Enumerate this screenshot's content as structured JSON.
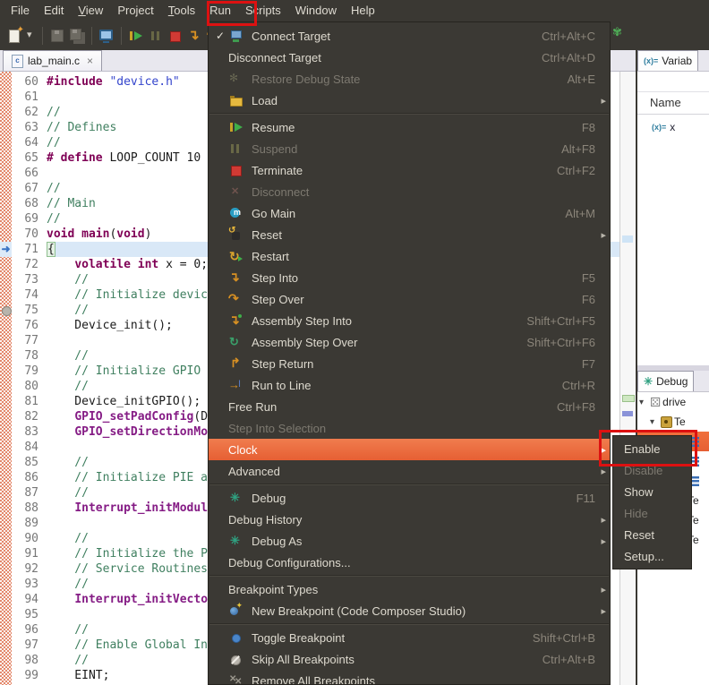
{
  "menubar": {
    "items": [
      {
        "label": "File",
        "underline": false
      },
      {
        "label": "Edit",
        "underline": false
      },
      {
        "label": "View",
        "underline": true
      },
      {
        "label": "Project",
        "underline": false
      },
      {
        "label": "Tools",
        "underline": true
      },
      {
        "label": "Run",
        "underline": false
      },
      {
        "label": "Scripts",
        "underline": false
      },
      {
        "label": "Window",
        "underline": false
      },
      {
        "label": "Help",
        "underline": false
      }
    ]
  },
  "toolbar": {
    "groups": [
      [
        {
          "icon": "new-file",
          "disabled": false
        },
        {
          "icon": "menu-dropdown-arrow",
          "disabled": false
        }
      ],
      [
        {
          "icon": "save",
          "disabled": true
        },
        {
          "icon": "save-all",
          "disabled": true
        }
      ],
      [
        {
          "icon": "debug-monitor",
          "disabled": false
        }
      ],
      [
        {
          "icon": "resume",
          "disabled": false
        },
        {
          "icon": "suspend",
          "disabled": true
        },
        {
          "icon": "terminate",
          "disabled": false
        },
        {
          "icon": "step-into",
          "disabled": false
        },
        {
          "icon": "step-over",
          "disabled": false
        },
        {
          "icon": "step-return",
          "disabled": false
        }
      ],
      [
        {
          "icon": "registers-grid",
          "disabled": false
        }
      ]
    ],
    "right_icon": "pin"
  },
  "editor": {
    "tab": {
      "label": "lab_main.c",
      "close": "×",
      "file_icon": "c"
    },
    "pointer_line": 71,
    "marker_line": 75,
    "lines": [
      {
        "num": 60,
        "segs": [
          [
            "#include",
            "kw"
          ],
          [
            " ",
            "pl"
          ],
          [
            "\"device.h\"",
            "str"
          ]
        ]
      },
      {
        "num": 61,
        "segs": []
      },
      {
        "num": 62,
        "segs": [
          [
            "//",
            "com"
          ]
        ]
      },
      {
        "num": 63,
        "segs": [
          [
            "// Defines",
            "com"
          ]
        ]
      },
      {
        "num": 64,
        "segs": [
          [
            "//",
            "com"
          ]
        ]
      },
      {
        "num": 65,
        "segs": [
          [
            "# define",
            "kw"
          ],
          [
            " LOOP_COUNT 10",
            "pl"
          ]
        ]
      },
      {
        "num": 66,
        "segs": []
      },
      {
        "num": 67,
        "segs": [
          [
            "//",
            "com"
          ]
        ]
      },
      {
        "num": 68,
        "segs": [
          [
            "// Main",
            "com"
          ]
        ]
      },
      {
        "num": 69,
        "segs": [
          [
            "//",
            "com"
          ]
        ]
      },
      {
        "num": 70,
        "segs": [
          [
            "void",
            "kw"
          ],
          [
            " ",
            "pl"
          ],
          [
            "main",
            "kw"
          ],
          [
            "(",
            "pl"
          ],
          [
            "void",
            "kw"
          ],
          [
            ")",
            "pl"
          ]
        ]
      },
      {
        "num": 71,
        "current": true,
        "segs": [
          [
            "{",
            "br"
          ]
        ]
      },
      {
        "num": 72,
        "segs": [
          [
            "    ",
            "pl"
          ],
          [
            "volatile",
            "kw"
          ],
          [
            " ",
            "pl"
          ],
          [
            "int",
            "kw"
          ],
          [
            " x = 0;",
            "pl"
          ]
        ]
      },
      {
        "num": 73,
        "segs": [
          [
            "    //",
            "com"
          ]
        ]
      },
      {
        "num": 74,
        "segs": [
          [
            "    // Initialize device",
            "com"
          ]
        ]
      },
      {
        "num": 75,
        "segs": [
          [
            "    //",
            "com"
          ]
        ]
      },
      {
        "num": 76,
        "segs": [
          [
            "    Device_init();",
            "pl"
          ]
        ]
      },
      {
        "num": 77,
        "segs": []
      },
      {
        "num": 78,
        "segs": [
          [
            "    //",
            "com"
          ]
        ]
      },
      {
        "num": 79,
        "segs": [
          [
            "    // Initialize GPIO a",
            "com"
          ]
        ]
      },
      {
        "num": 80,
        "segs": [
          [
            "    //",
            "com"
          ]
        ]
      },
      {
        "num": 81,
        "segs": [
          [
            "    Device_initGPIO();",
            "pl"
          ]
        ]
      },
      {
        "num": 82,
        "segs": [
          [
            "    ",
            "pl"
          ],
          [
            "GPIO_setPadConfig",
            "fn"
          ],
          [
            "(DE",
            "pl"
          ]
        ]
      },
      {
        "num": 83,
        "segs": [
          [
            "    ",
            "pl"
          ],
          [
            "GPIO_setDirectionMod",
            "fn"
          ]
        ]
      },
      {
        "num": 84,
        "segs": []
      },
      {
        "num": 85,
        "segs": [
          [
            "    //",
            "com"
          ]
        ]
      },
      {
        "num": 86,
        "segs": [
          [
            "    // Initialize PIE an",
            "com"
          ]
        ]
      },
      {
        "num": 87,
        "segs": [
          [
            "    //",
            "com"
          ]
        ]
      },
      {
        "num": 88,
        "segs": [
          [
            "    ",
            "pl"
          ],
          [
            "Interrupt_initModule",
            "fn"
          ]
        ]
      },
      {
        "num": 89,
        "segs": []
      },
      {
        "num": 90,
        "segs": [
          [
            "    //",
            "com"
          ]
        ]
      },
      {
        "num": 91,
        "segs": [
          [
            "    // Initialize the PI",
            "com"
          ]
        ]
      },
      {
        "num": 92,
        "segs": [
          [
            "    // Service Routines",
            "com"
          ]
        ]
      },
      {
        "num": 93,
        "segs": [
          [
            "    //",
            "com"
          ]
        ]
      },
      {
        "num": 94,
        "segs": [
          [
            "    ",
            "pl"
          ],
          [
            "Interrupt_initVector",
            "fn"
          ]
        ]
      },
      {
        "num": 95,
        "segs": []
      },
      {
        "num": 96,
        "segs": [
          [
            "    //",
            "com"
          ]
        ]
      },
      {
        "num": 97,
        "segs": [
          [
            "    // Enable Global Int",
            "com"
          ]
        ]
      },
      {
        "num": 98,
        "segs": [
          [
            "    //",
            "com"
          ]
        ]
      },
      {
        "num": 99,
        "segs": [
          [
            "    EINT;",
            "pl"
          ]
        ]
      }
    ]
  },
  "run_menu": {
    "items": [
      {
        "label": "Connect Target",
        "shortcut": "Ctrl+Alt+C",
        "icon": "connect-target",
        "checked": true,
        "state": "enabled"
      },
      {
        "label": "Disconnect Target",
        "shortcut": "Ctrl+Alt+D",
        "icon": "",
        "state": "enabled"
      },
      {
        "label": "Restore Debug State",
        "shortcut": "Alt+E",
        "icon": "restore-debug",
        "state": "disabled"
      },
      {
        "label": "Load",
        "shortcut": "",
        "icon": "load",
        "state": "enabled",
        "arrow": true,
        "sep_after": true
      },
      {
        "label": "Resume",
        "shortcut": "F8",
        "icon": "resume",
        "state": "enabled"
      },
      {
        "label": "Suspend",
        "shortcut": "Alt+F8",
        "icon": "suspend",
        "state": "disabled"
      },
      {
        "label": "Terminate",
        "shortcut": "Ctrl+F2",
        "icon": "terminate",
        "state": "enabled"
      },
      {
        "label": "Disconnect",
        "shortcut": "",
        "icon": "disconnect",
        "state": "disabled"
      },
      {
        "label": "Go Main",
        "shortcut": "Alt+M",
        "icon": "go-main",
        "state": "enabled"
      },
      {
        "label": "Reset",
        "shortcut": "",
        "icon": "reset",
        "state": "enabled",
        "arrow": true
      },
      {
        "label": "Restart",
        "shortcut": "",
        "icon": "restart",
        "state": "enabled"
      },
      {
        "label": "Step Into",
        "shortcut": "F5",
        "icon": "step-into",
        "state": "enabled"
      },
      {
        "label": "Step Over",
        "shortcut": "F6",
        "icon": "step-over",
        "state": "enabled"
      },
      {
        "label": "Assembly Step Into",
        "shortcut": "Shift+Ctrl+F5",
        "icon": "asm-step-into",
        "state": "enabled"
      },
      {
        "label": "Assembly Step Over",
        "shortcut": "Shift+Ctrl+F6",
        "icon": "asm-step-over",
        "state": "enabled"
      },
      {
        "label": "Step Return",
        "shortcut": "F7",
        "icon": "step-return",
        "state": "enabled"
      },
      {
        "label": "Run to Line",
        "shortcut": "Ctrl+R",
        "icon": "run-to-line",
        "state": "enabled"
      },
      {
        "label": "Free Run",
        "shortcut": "Ctrl+F8",
        "icon": "",
        "state": "enabled"
      },
      {
        "label": "Step Into Selection",
        "shortcut": "",
        "icon": "",
        "state": "disabled"
      },
      {
        "label": "Clock",
        "shortcut": "",
        "icon": "",
        "state": "selected",
        "arrow": true
      },
      {
        "label": "Advanced",
        "shortcut": "",
        "icon": "",
        "state": "enabled",
        "arrow": true,
        "sep_after": true
      },
      {
        "label": "Debug",
        "shortcut": "F11",
        "icon": "debug",
        "state": "enabled"
      },
      {
        "label": "Debug History",
        "shortcut": "",
        "icon": "",
        "state": "enabled",
        "arrow": true
      },
      {
        "label": "Debug As",
        "shortcut": "",
        "icon": "debug",
        "state": "enabled",
        "arrow": true
      },
      {
        "label": "Debug Configurations...",
        "shortcut": "",
        "icon": "",
        "state": "enabled",
        "sep_after": true
      },
      {
        "label": "Breakpoint Types",
        "shortcut": "",
        "icon": "",
        "state": "enabled",
        "arrow": true
      },
      {
        "label": "New Breakpoint (Code Composer Studio)",
        "shortcut": "",
        "icon": "new-breakpoint",
        "state": "enabled",
        "arrow": true,
        "sep_after": true
      },
      {
        "label": "Toggle Breakpoint",
        "shortcut": "Shift+Ctrl+B",
        "icon": "toggle-breakpoint",
        "state": "enabled"
      },
      {
        "label": "Skip All Breakpoints",
        "shortcut": "Ctrl+Alt+B",
        "icon": "skip-breakpoints",
        "state": "enabled"
      },
      {
        "label": "Remove All Breakpoints",
        "shortcut": "",
        "icon": "remove-breakpoints",
        "state": "enabled"
      }
    ]
  },
  "clock_submenu": {
    "items": [
      {
        "label": "Enable",
        "state": "enabled",
        "annotated": true
      },
      {
        "label": "Disable",
        "state": "disabled"
      },
      {
        "label": "Show",
        "state": "enabled"
      },
      {
        "label": "Hide",
        "state": "disabled"
      },
      {
        "label": "Reset",
        "state": "enabled"
      },
      {
        "label": "Setup...",
        "state": "enabled"
      }
    ]
  },
  "variables_panel": {
    "tab_label": "Variab",
    "tab_icon": "(x)=",
    "header": "Name",
    "rows": [
      {
        "icon": "(x)=",
        "name": "x"
      }
    ]
  },
  "debug_panel": {
    "tab_label": "Debug",
    "rows": [
      {
        "expander": "▼",
        "icon": "dice",
        "label": "drive",
        "indent": 2
      },
      {
        "expander": "▼",
        "icon": "chip",
        "label": "Te",
        "indent": 14
      },
      {
        "expander": "",
        "icon": "stack",
        "label": "",
        "indent": 56,
        "selected": true
      },
      {
        "expander": "",
        "icon": "stack",
        "label": "",
        "indent": 56
      },
      {
        "expander": "",
        "icon": "stack",
        "label": "",
        "indent": 56
      },
      {
        "expander": "",
        "icon": "",
        "label": "Te",
        "indent": 56
      },
      {
        "expander": "",
        "icon": "",
        "label": "Te",
        "indent": 56
      },
      {
        "expander": "",
        "icon": "",
        "label": "Te",
        "indent": 56
      }
    ]
  },
  "colors": {
    "selection_orange": "#ee6a3c",
    "annotation_red": "#dd1111",
    "menu_background": "#3b3934",
    "keyword": "#7f0055",
    "string": "#3344cc",
    "comment": "#3f7f5f",
    "function": "#851c85"
  }
}
